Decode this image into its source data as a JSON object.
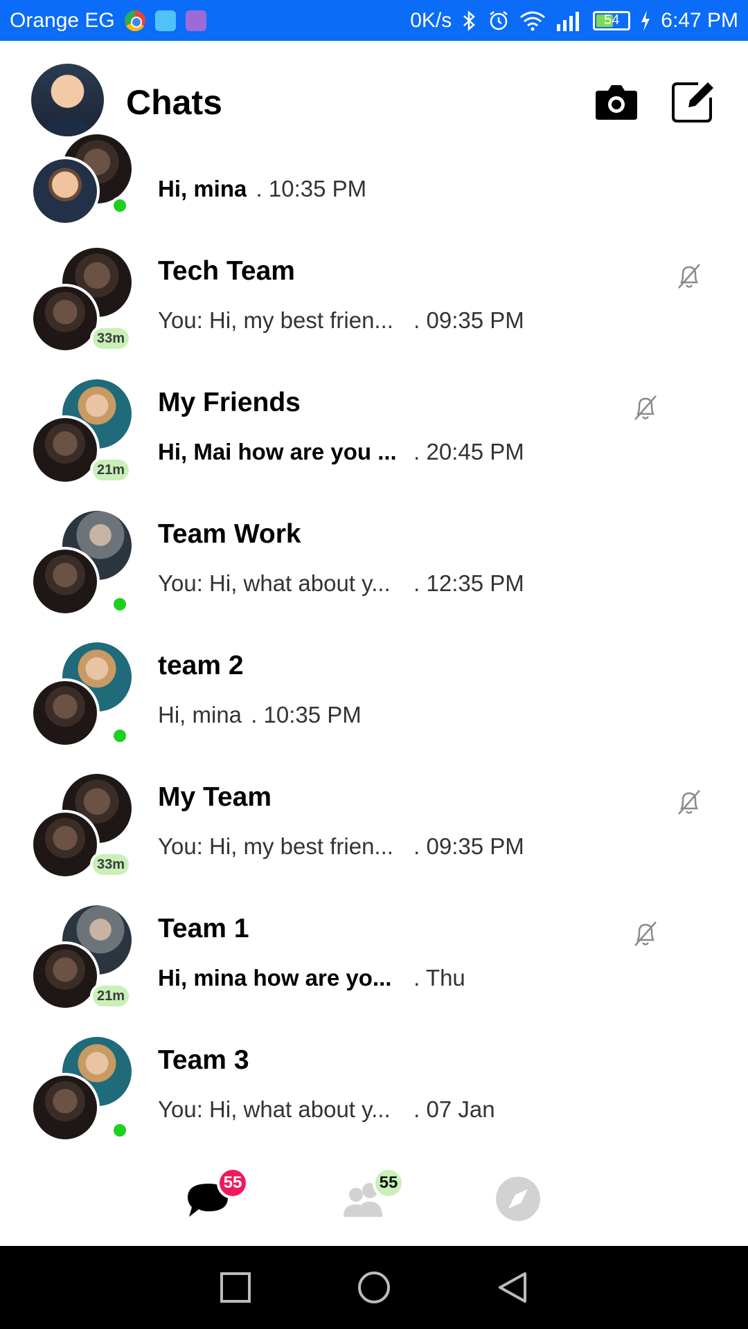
{
  "status_bar": {
    "carrier": "Orange EG",
    "speed": "0K/s",
    "battery": "54",
    "time": "6:47 PM"
  },
  "header": {
    "title": "Chats"
  },
  "chats": [
    {
      "name": "",
      "message": "Hi, mina",
      "time": ". 10:35 PM",
      "unread": true,
      "muted": false,
      "indicator": "online"
    },
    {
      "name": "Tech Team",
      "message": "You: Hi, my best frien...",
      "time": ". 09:35 PM",
      "unread": false,
      "muted": true,
      "indicator": "33m"
    },
    {
      "name": "My Friends",
      "message": "Hi, Mai how are you ...",
      "time": ". 20:45 PM",
      "unread": true,
      "muted": true,
      "indicator": "21m"
    },
    {
      "name": "Team Work",
      "message": "You: Hi, what about y...",
      "time": ". 12:35 PM",
      "unread": false,
      "muted": false,
      "indicator": "online"
    },
    {
      "name": "team 2",
      "message": "Hi, mina",
      "time": ". 10:35 PM",
      "unread": false,
      "muted": false,
      "indicator": "online"
    },
    {
      "name": "My Team",
      "message": "You: Hi, my best frien...",
      "time": ". 09:35 PM",
      "unread": false,
      "muted": true,
      "indicator": "33m"
    },
    {
      "name": "Team 1",
      "message": "Hi, mina how are yo...",
      "time": ". Thu",
      "unread": true,
      "muted": true,
      "indicator": "21m"
    },
    {
      "name": "Team 3",
      "message": "You: Hi, what about y...",
      "time": ". 07 Jan",
      "unread": false,
      "muted": false,
      "indicator": "online"
    }
  ],
  "tabs": {
    "chats_badge": "55",
    "people_badge": "55"
  },
  "colors": {
    "status_bar": "#0b6cf8",
    "online": "#1ed01e",
    "badge_red": "#ee1a5c",
    "badge_green": "#c9f0b8"
  }
}
